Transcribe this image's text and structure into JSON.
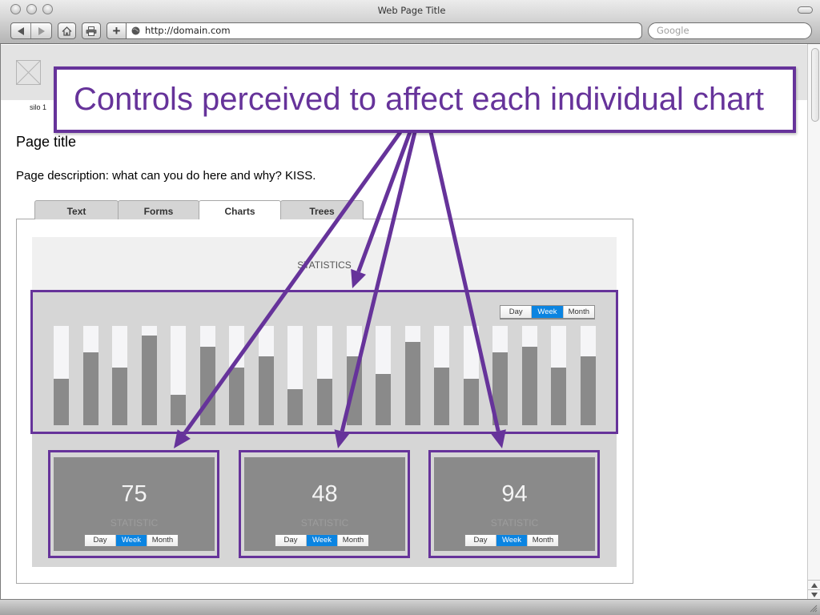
{
  "window": {
    "title": "Web Page Title",
    "controls": [
      "close-light-icon",
      "minimize-light-icon",
      "zoom-light-icon"
    ]
  },
  "toolbar": {
    "url": "http://domain.com",
    "search_placeholder": "Google",
    "icons": [
      "back-arrow-icon",
      "forward-arrow-icon",
      "home-icon",
      "print-icon",
      "plus-icon",
      "globe-icon"
    ]
  },
  "site_header": {
    "logo_icon": "image-placeholder-icon"
  },
  "nav": {
    "silos": [
      "silo 1"
    ]
  },
  "page": {
    "title": "Page title",
    "description": "Page description: what can you do here and why? KISS."
  },
  "tabs": [
    {
      "label": "Text",
      "active": false
    },
    {
      "label": "Forms",
      "active": false
    },
    {
      "label": "Charts",
      "active": true
    },
    {
      "label": "Trees",
      "active": false
    }
  ],
  "dashboard": {
    "heading": "STATISTICS",
    "main_chart": {
      "range_options": [
        "Day",
        "Week",
        "Month"
      ],
      "selected": "Week"
    },
    "cards": [
      {
        "value": "75",
        "label": "STATISTIC",
        "range_options": [
          "Day",
          "Week",
          "Month"
        ],
        "selected": "Week"
      },
      {
        "value": "48",
        "label": "STATISTIC",
        "range_options": [
          "Day",
          "Week",
          "Month"
        ],
        "selected": "Week"
      },
      {
        "value": "94",
        "label": "STATISTIC",
        "range_options": [
          "Day",
          "Week",
          "Month"
        ],
        "selected": "Week"
      }
    ]
  },
  "annotation": {
    "text": "Controls perceived to affect each individual chart",
    "targets": [
      "card-1",
      "main-chart",
      "card-2",
      "card-3"
    ]
  },
  "colors": {
    "accent": "#66339a",
    "selected": "#0b84e1",
    "bar_track": "#f5f5f7",
    "bar_fill": "#8a8a8a",
    "panel": "#d6d6d6"
  },
  "chart_data": {
    "type": "bar",
    "title": "STATISTICS",
    "xlabel": "",
    "ylabel": "",
    "ylim": [
      0,
      100
    ],
    "grid": false,
    "categories": [],
    "values": [
      47,
      73,
      58,
      90,
      31,
      79,
      58,
      69,
      36,
      47,
      69,
      52,
      84,
      58,
      47,
      73,
      79,
      58,
      69
    ]
  }
}
